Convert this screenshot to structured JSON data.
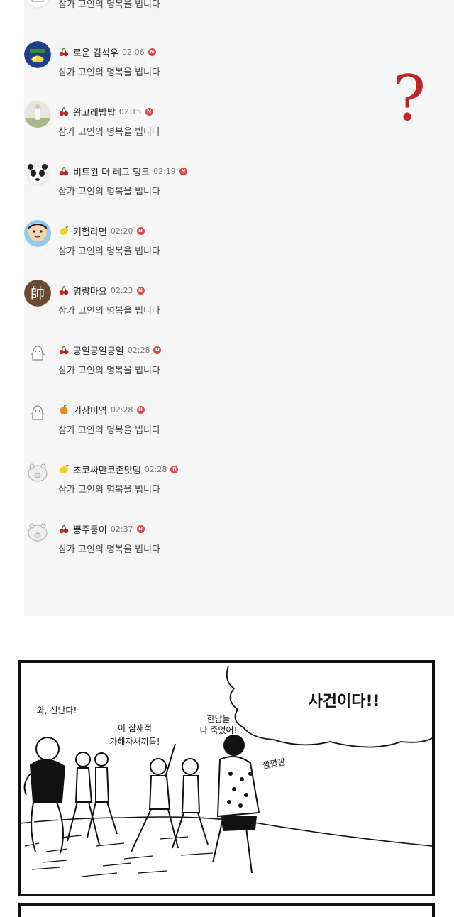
{
  "comments": [
    {
      "nickname": "",
      "time": "",
      "text": "삼가 고인의 명복을 빕니다",
      "level": "cherry",
      "new_badge": ""
    },
    {
      "nickname": "로운 김석우",
      "time": "02:06",
      "text": "삼가 고인의 명복을 빕니다",
      "level": "cherry",
      "new_badge": "N"
    },
    {
      "nickname": "왕고래밥밥",
      "time": "02:15",
      "text": "삼가 고인의 명복을 빕니다",
      "level": "cherry",
      "new_badge": "N"
    },
    {
      "nickname": "비트윈 더 레그 덩크",
      "time": "02:19",
      "text": "삼가 고인의 명복을 빕니다",
      "level": "cherry",
      "new_badge": "N"
    },
    {
      "nickname": "커헙라면",
      "time": "02:20",
      "text": "삼가 고인의 명복을 빕니다",
      "level": "lemon",
      "new_badge": "N"
    },
    {
      "nickname": "명량마요",
      "time": "02:23",
      "text": "삼가 고인의 명복을 빕니다",
      "level": "cherry",
      "new_badge": "N"
    },
    {
      "nickname": "공일공일공일",
      "time": "02:28",
      "text": "삼가 고인의 명복을 빕니다",
      "level": "cherry",
      "new_badge": "N"
    },
    {
      "nickname": "기장미역",
      "time": "02:28",
      "text": "삼가 고인의 명복을 빕니다",
      "level": "orange",
      "new_badge": "N"
    },
    {
      "nickname": "초코싸만코존맛탱",
      "time": "02:28",
      "text": "삼가 고인의 명복을 빕니다",
      "level": "lemon",
      "new_badge": "N"
    },
    {
      "nickname": "뽕주둥이",
      "time": "02:37",
      "text": "삼가 고인의 명복을 빕니다",
      "level": "cherry",
      "new_badge": "N"
    }
  ],
  "question_mark": "?",
  "avatar_5_glyph": "帥",
  "comic": {
    "title": "사건이다!!",
    "bubble_1": "와, 신난다!",
    "bubble_2_line_1": "이 잠재적",
    "bubble_2_line_2": "가해자새끼들!",
    "bubble_3_line_1": "한남들",
    "bubble_3_line_2": "다 죽었어!",
    "bubble_4": "깔깔깔"
  },
  "colors": {
    "panel": "#f6f6f6",
    "new_badge": "#d84848",
    "question_mark": "#b52a2a"
  }
}
